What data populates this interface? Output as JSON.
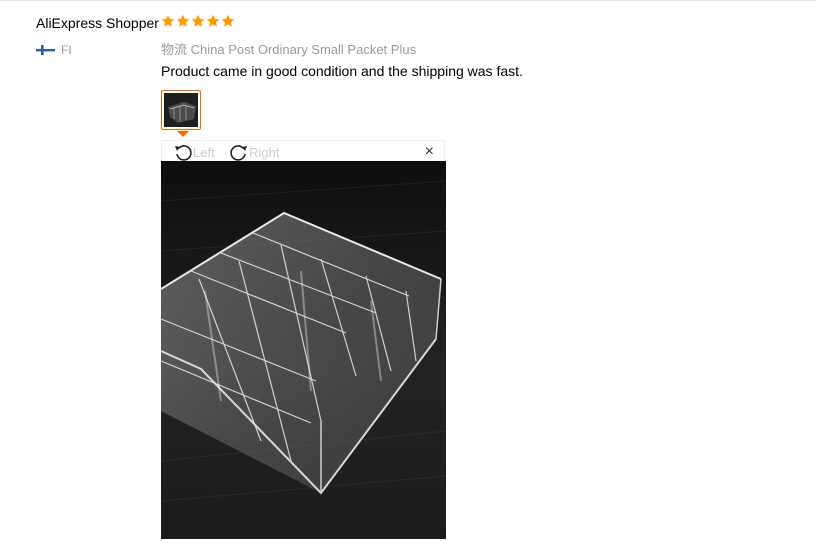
{
  "review": {
    "user_name": "AliExpress Shopper",
    "country_code": "FI",
    "rating": 5,
    "star_color": "#ff9900",
    "logistics_label": "物流",
    "logistics_value": "China Post Ordinary Small Packet Plus",
    "text": "Product came in good condition and the shipping was fast."
  },
  "viewer": {
    "rotate_left_label": "Left",
    "rotate_right_label": "Right",
    "close_glyph": "×"
  },
  "icons": {
    "flag": "finland-flag-icon",
    "rotate_left": "rotate-left-icon",
    "rotate_right": "rotate-right-icon",
    "close": "close-icon",
    "star": "star-icon"
  }
}
